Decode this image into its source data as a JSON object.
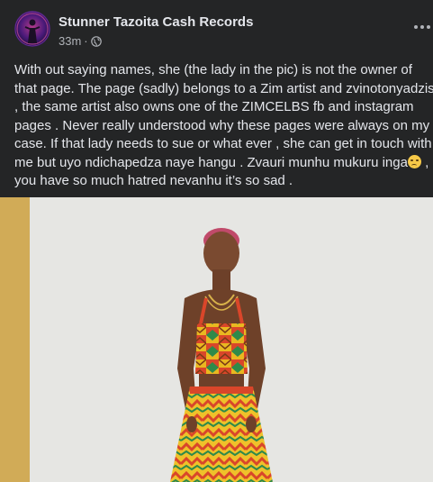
{
  "post": {
    "author": "Stunner Tazoita Cash Records",
    "timestamp": "33m",
    "separator": "·",
    "more_icon": "ellipsis-icon",
    "privacy_icon": "globe-icon",
    "text_lines": [
      "With out saying names, she (the lady in the pic)  is not the owner of",
      "that page. The page (sadly) belongs to a Zim artist and zvinotonyadzisa",
      ", the same artist also owns one of the ZIMCELBS fb and instagram",
      "pages .  Never really understood why these pages were always on my",
      "case.  If that lady needs to sue or what ever , she can get in touch with",
      "me but uyo ndichapedza naye hangu . Zvauri munhu mukuru inga",
      "you have so much hatred nevanhu it’s so sad ."
    ],
    "line6_suffix": " ,",
    "emoji": "sad-face-emoji"
  },
  "colors": {
    "background": "#242526",
    "text_primary": "#e4e6eb",
    "text_secondary": "#b0b3b8",
    "media_border": "#d1ab57"
  }
}
